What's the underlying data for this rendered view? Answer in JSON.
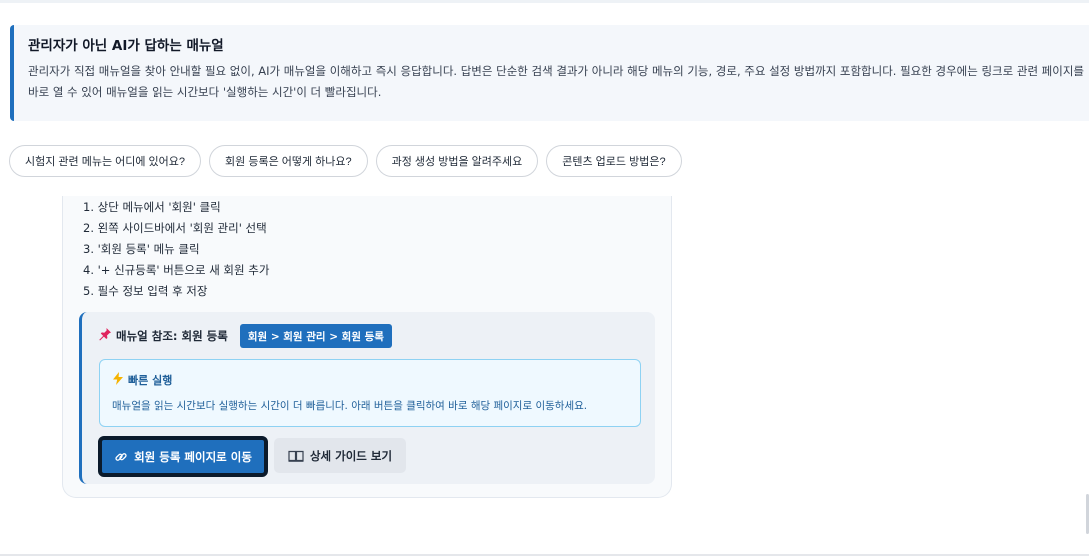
{
  "intro": {
    "title": "관리자가 아닌 AI가 답하는 매뉴얼",
    "body": "관리자가 직접 매뉴얼을 찾아 안내할 필요 없이, AI가 매뉴얼을 이해하고 즉시 응답합니다. 답변은 단순한 검색 결과가 아니라 해당 메뉴의 기능, 경로, 주요 설정 방법까지 포함합니다. 필요한 경우에는 링크로 관련 페이지를 바로 열 수 있어 매뉴얼을 읽는 시간보다 '실행하는 시간'이 더 빨라집니다."
  },
  "suggestions": [
    "시험지 관련 메뉴는 어디에 있어요?",
    "회원 등록은 어떻게 하나요?",
    "과정 생성 방법을 알려주세요",
    "콘텐츠 업로드 방법은?"
  ],
  "answer": {
    "steps": [
      "1. 상단 메뉴에서 '회원' 클릭",
      "2. 왼쪽 사이드바에서 '회원 관리' 선택",
      "3. '회원 등록' 메뉴 클릭",
      "4. '+ 신규등록' 버튼으로 새 회원 추가",
      "5. 필수 정보 입력 후 저장"
    ],
    "reference": {
      "icon": "pushpin-icon",
      "label": "매뉴얼 참조: 회원 등록",
      "path": "회원 > 회원 관리 > 회원 등록",
      "quick": {
        "icon": "lightning-icon",
        "title": "빠른 실행",
        "desc": "매뉴얼을 읽는 시간보다 실행하는 시간이 더 빠릅니다. 아래 버튼을 클릭하여 바로 해당 페이지로 이동하세요."
      },
      "primary_button": {
        "icon": "link-icon",
        "label": "회원 등록 페이지로 이동"
      },
      "secondary_button": {
        "icon": "book-icon",
        "label": "상세 가이드 보기"
      }
    }
  },
  "colors": {
    "accent": "#1f6fbd",
    "quick_border": "#8ed2f3",
    "quick_text": "#1f5f99",
    "primary_focus_ring": "#0b1a2b"
  }
}
